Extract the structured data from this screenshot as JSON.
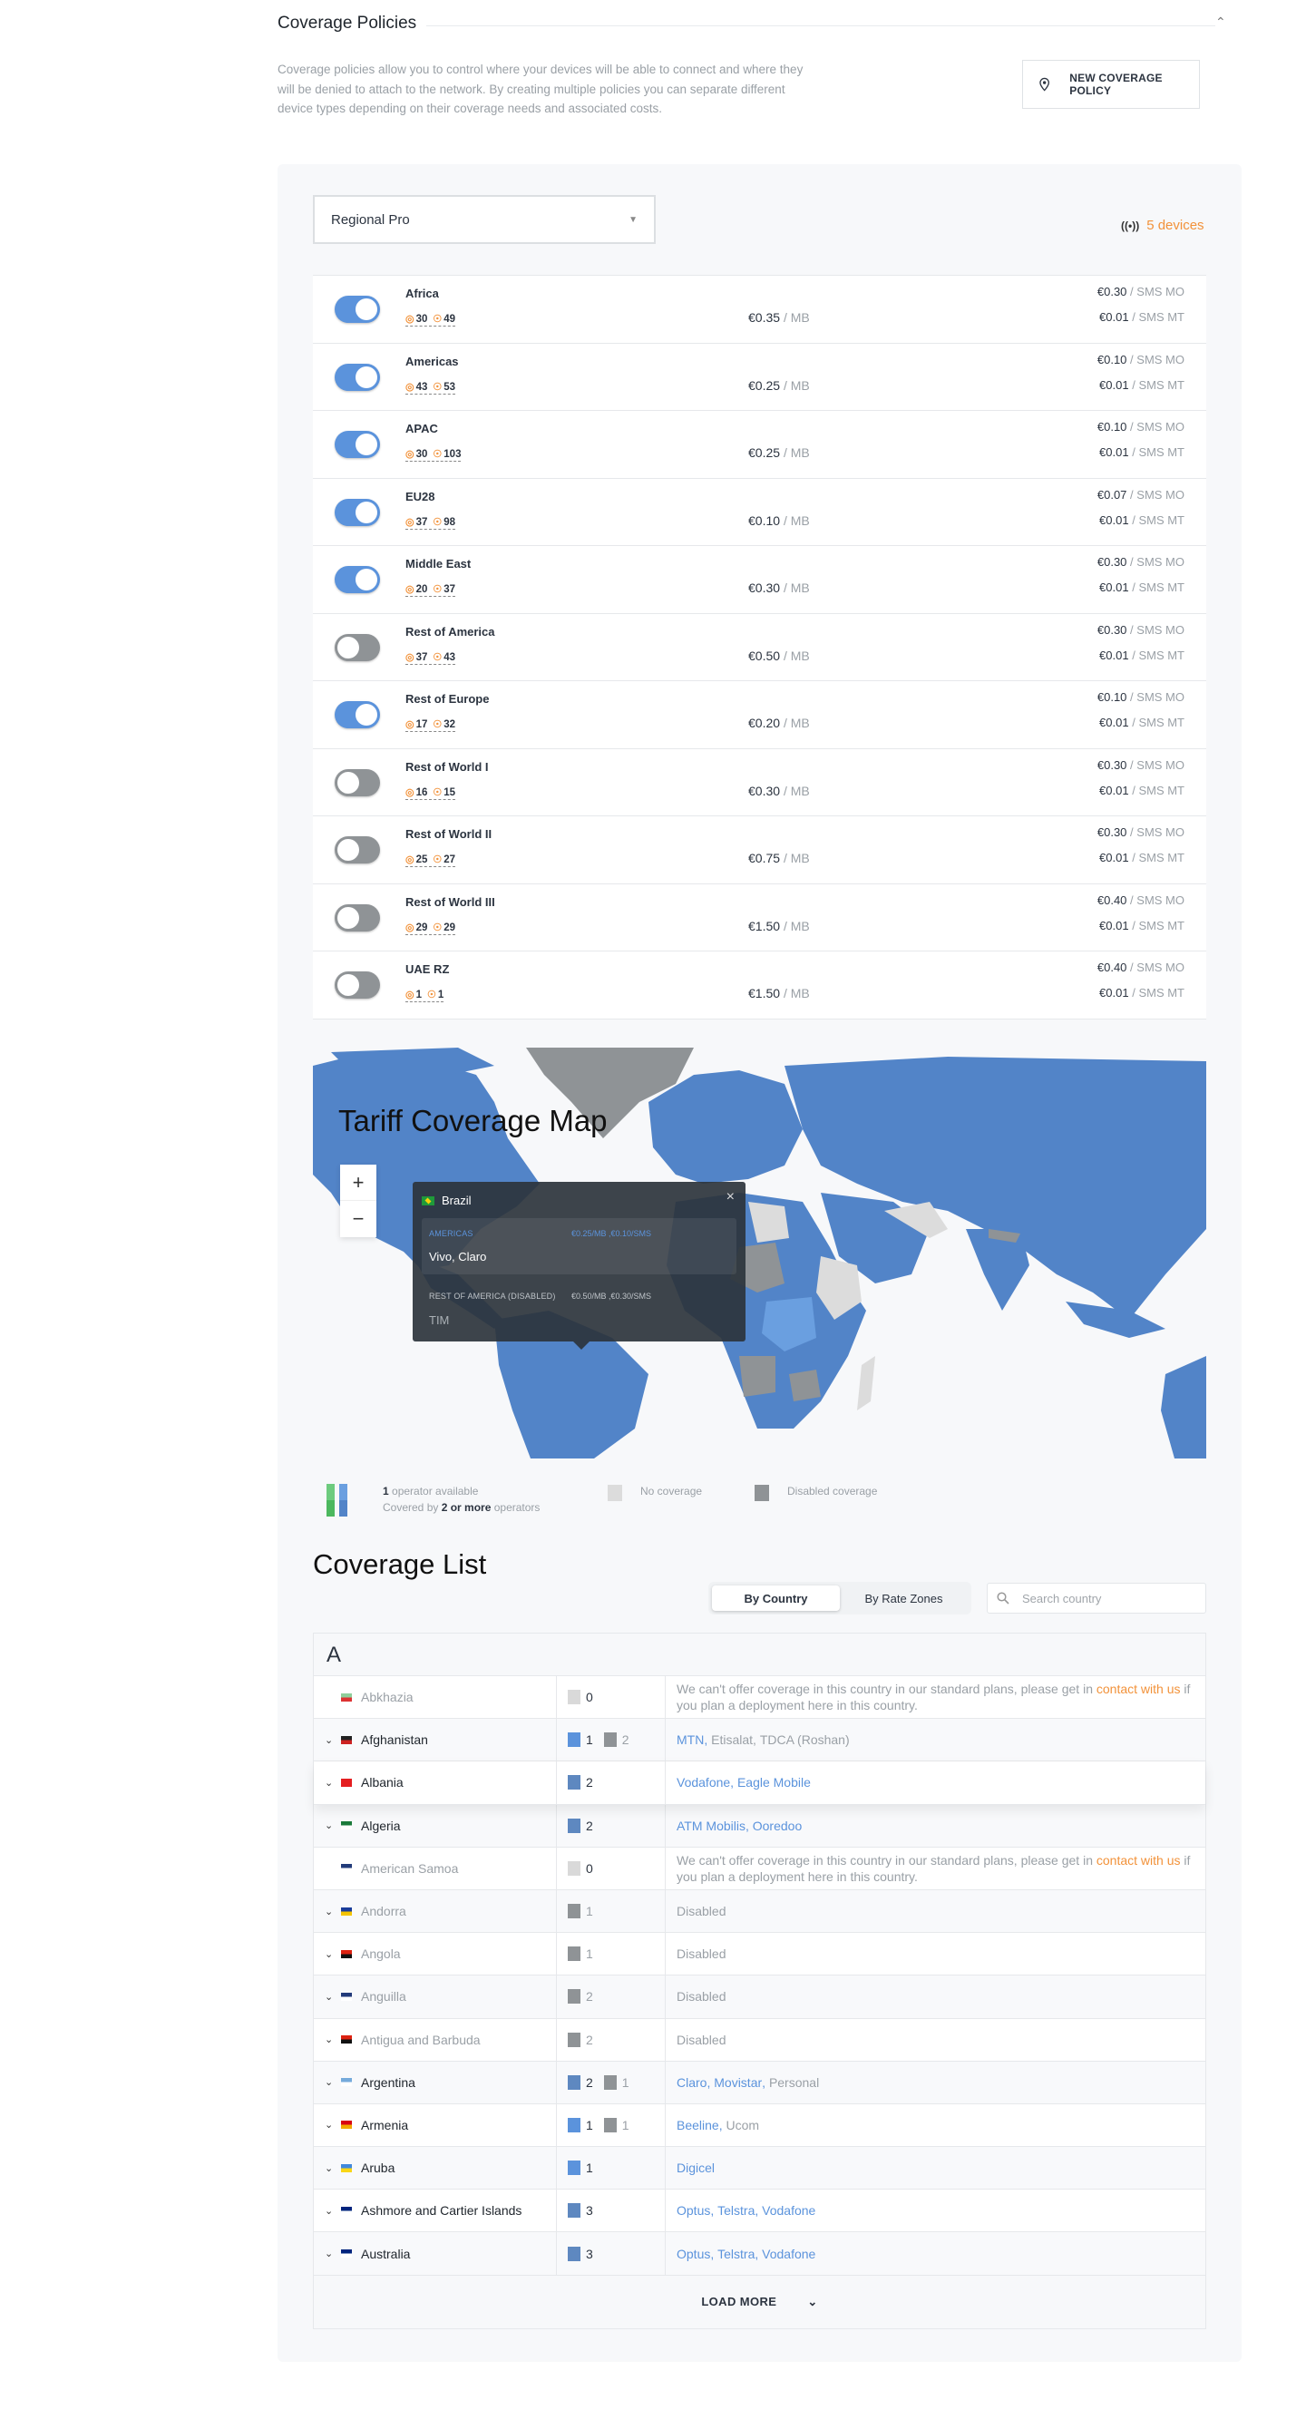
{
  "header": {
    "title": "Coverage Policies",
    "collapse_icon": "chevron-up-icon",
    "description": "Coverage policies allow you to control where your devices will be able to connect and where they will be denied to attach to the network. By creating multiple policies you can separate different device types depending on their coverage needs and associated costs.",
    "new_policy_label": "NEW COVERAGE POLICY",
    "new_policy_icon": "map-pin-icon"
  },
  "policy": {
    "selected": "Regional Pro",
    "devices_label": "5 devices",
    "devices_icon": "broadcast-icon",
    "colors": {
      "toggle_on": "#5b93dc",
      "toggle_off": "#8f9396",
      "accent": "#f2923a"
    }
  },
  "zones": [
    {
      "name": "Africa",
      "enabled": true,
      "countries": "30",
      "operators": "49",
      "price_mb": "€0.35",
      "sms_mo": "€0.30",
      "sms_mt": "€0.01"
    },
    {
      "name": "Americas",
      "enabled": true,
      "countries": "43",
      "operators": "53",
      "price_mb": "€0.25",
      "sms_mo": "€0.10",
      "sms_mt": "€0.01"
    },
    {
      "name": "APAC",
      "enabled": true,
      "countries": "30",
      "operators": "103",
      "price_mb": "€0.25",
      "sms_mo": "€0.10",
      "sms_mt": "€0.01"
    },
    {
      "name": "EU28",
      "enabled": true,
      "countries": "37",
      "operators": "98",
      "price_mb": "€0.10",
      "sms_mo": "€0.07",
      "sms_mt": "€0.01"
    },
    {
      "name": "Middle East",
      "enabled": true,
      "countries": "20",
      "operators": "37",
      "price_mb": "€0.30",
      "sms_mo": "€0.30",
      "sms_mt": "€0.01"
    },
    {
      "name": "Rest of America",
      "enabled": false,
      "countries": "37",
      "operators": "43",
      "price_mb": "€0.50",
      "sms_mo": "€0.30",
      "sms_mt": "€0.01"
    },
    {
      "name": "Rest of Europe",
      "enabled": true,
      "countries": "17",
      "operators": "32",
      "price_mb": "€0.20",
      "sms_mo": "€0.10",
      "sms_mt": "€0.01"
    },
    {
      "name": "Rest of World I",
      "enabled": false,
      "countries": "16",
      "operators": "15",
      "price_mb": "€0.30",
      "sms_mo": "€0.30",
      "sms_mt": "€0.01"
    },
    {
      "name": "Rest of World II",
      "enabled": false,
      "countries": "25",
      "operators": "27",
      "price_mb": "€0.75",
      "sms_mo": "€0.30",
      "sms_mt": "€0.01"
    },
    {
      "name": "Rest of World III",
      "enabled": false,
      "countries": "29",
      "operators": "29",
      "price_mb": "€1.50",
      "sms_mo": "€0.40",
      "sms_mt": "€0.01"
    },
    {
      "name": "UAE RZ",
      "enabled": false,
      "countries": "1",
      "operators": "1",
      "price_mb": "€1.50",
      "sms_mo": "€0.40",
      "sms_mt": "€0.01"
    }
  ],
  "zone_units": {
    "mb": "/ MB",
    "sms_mo": "/ SMS MO",
    "sms_mt": "/ SMS MT"
  },
  "map": {
    "title": "Tariff Coverage Map",
    "zoom_in": "+",
    "zoom_out": "−",
    "colors": {
      "covered_multi": "#5284c8",
      "covered_single": "#6a9fe0",
      "no_coverage": "#dcdcdc",
      "disabled": "#8f9396",
      "water": "#f7f8fa"
    },
    "tooltip": {
      "country": "Brazil",
      "close": "×",
      "zones": [
        {
          "zone": "AMERICAS",
          "price": "€0.25/MB ,€0.10/SMS",
          "operators": "Vivo, Claro",
          "active": true
        },
        {
          "zone": "REST OF AMERICA (DISABLED)",
          "price": "€0.50/MB ,€0.30/SMS",
          "operators": "TIM",
          "active": false
        }
      ]
    }
  },
  "legend": {
    "one_count": "1",
    "one_text": " operator available",
    "multi_prefix": "Covered by ",
    "multi_bold": "2 or more",
    "multi_suffix": " operators",
    "no_coverage": "No coverage",
    "disabled": "Disabled coverage"
  },
  "coverage_list": {
    "title": "Coverage List",
    "tabs": [
      {
        "label": "By Country",
        "active": true
      },
      {
        "label": "By Rate Zones",
        "active": false
      }
    ],
    "search_placeholder": "Search country",
    "letter": "A",
    "no_coverage_text_1": "We can't offer coverage in this country in our standard plans, please get in ",
    "contact_link": "contact with us",
    "no_coverage_text_2": " if you plan a deployment here in this country.",
    "load_more": "LOAD MORE",
    "rows": [
      {
        "country": "Abkhazia",
        "status": "none",
        "counts": [
          {
            "type": "none",
            "n": "0"
          }
        ],
        "operators": [],
        "flag": [
          "#8fcf9b",
          "#d33"
        ]
      },
      {
        "country": "Afghanistan",
        "status": "active",
        "counts": [
          {
            "type": "blue1",
            "n": "1"
          },
          {
            "type": "grey",
            "n": "2"
          }
        ],
        "operators": [
          {
            "name": "MTN",
            "on": true
          },
          {
            "name": "Etisalat",
            "on": false
          },
          {
            "name": "TDCA (Roshan)",
            "on": false
          }
        ],
        "flag": [
          "#222",
          "#c22"
        ]
      },
      {
        "country": "Albania",
        "status": "active",
        "counts": [
          {
            "type": "blue2",
            "n": "2"
          }
        ],
        "operators": [
          {
            "name": "Vodafone",
            "on": true
          },
          {
            "name": "Eagle Mobile",
            "on": true
          }
        ],
        "flag": [
          "#e41e20",
          "#e41e20"
        ]
      },
      {
        "country": "Algeria",
        "status": "active",
        "counts": [
          {
            "type": "blue2",
            "n": "2"
          }
        ],
        "operators": [
          {
            "name": "ATM Mobilis",
            "on": true
          },
          {
            "name": "Ooredoo",
            "on": true
          }
        ],
        "flag": [
          "#1a7a3a",
          "#fff"
        ]
      },
      {
        "country": "American Samoa",
        "status": "none",
        "counts": [
          {
            "type": "none",
            "n": "0"
          }
        ],
        "operators": [],
        "flag": [
          "#223b7a",
          "#fff"
        ]
      },
      {
        "country": "Andorra",
        "status": "disabled",
        "counts": [
          {
            "type": "grey",
            "n": "1"
          }
        ],
        "operators": [],
        "flag": [
          "#1a3d9a",
          "#f5c400"
        ]
      },
      {
        "country": "Angola",
        "status": "disabled",
        "counts": [
          {
            "type": "grey",
            "n": "1"
          }
        ],
        "operators": [],
        "flag": [
          "#d21",
          "#111"
        ]
      },
      {
        "country": "Anguilla",
        "status": "disabled",
        "counts": [
          {
            "type": "grey",
            "n": "2"
          }
        ],
        "operators": [],
        "flag": [
          "#223b7a",
          "#fff"
        ]
      },
      {
        "country": "Antigua and Barbuda",
        "status": "disabled",
        "counts": [
          {
            "type": "grey",
            "n": "2"
          }
        ],
        "operators": [],
        "flag": [
          "#d21",
          "#111"
        ]
      },
      {
        "country": "Argentina",
        "status": "active",
        "counts": [
          {
            "type": "blue2",
            "n": "2"
          },
          {
            "type": "grey",
            "n": "1"
          }
        ],
        "operators": [
          {
            "name": "Claro",
            "on": true
          },
          {
            "name": "Movistar",
            "on": true
          },
          {
            "name": "Personal",
            "on": false
          }
        ],
        "flag": [
          "#75aadb",
          "#fff"
        ]
      },
      {
        "country": "Armenia",
        "status": "active",
        "counts": [
          {
            "type": "blue1",
            "n": "1"
          },
          {
            "type": "grey",
            "n": "1"
          }
        ],
        "operators": [
          {
            "name": "Beeline",
            "on": true
          },
          {
            "name": "Ucom",
            "on": false
          }
        ],
        "flag": [
          "#d90012",
          "#f2a800"
        ]
      },
      {
        "country": "Aruba",
        "status": "active",
        "counts": [
          {
            "type": "blue1",
            "n": "1"
          }
        ],
        "operators": [
          {
            "name": "Digicel",
            "on": true
          }
        ],
        "flag": [
          "#4189dd",
          "#f9d616"
        ]
      },
      {
        "country": "Ashmore and Cartier Islands",
        "status": "active",
        "counts": [
          {
            "type": "blue2",
            "n": "3"
          }
        ],
        "operators": [
          {
            "name": "Optus",
            "on": true
          },
          {
            "name": "Telstra",
            "on": true
          },
          {
            "name": "Vodafone",
            "on": true
          }
        ],
        "flag": [
          "#00247d",
          "#fff"
        ]
      },
      {
        "country": "Australia",
        "status": "active",
        "counts": [
          {
            "type": "blue2",
            "n": "3"
          }
        ],
        "operators": [
          {
            "name": "Optus",
            "on": true
          },
          {
            "name": "Telstra",
            "on": true
          },
          {
            "name": "Vodafone",
            "on": true
          }
        ],
        "flag": [
          "#00247d",
          "#fff"
        ]
      }
    ],
    "disabled_text": "Disabled"
  }
}
